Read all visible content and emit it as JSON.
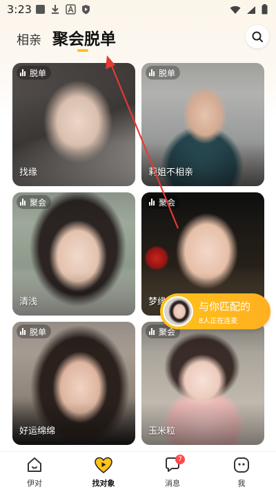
{
  "status_bar": {
    "time": "3:23"
  },
  "tabs": {
    "inactive": "相亲",
    "active": "聚会脱单"
  },
  "cards": [
    {
      "badge": "脱单",
      "name": "找缘",
      "palette": [
        "#6d6560",
        "#3b3735"
      ]
    },
    {
      "badge": "脱单",
      "name": "莉姐不相亲",
      "palette": [
        "#8a8f92",
        "#2d4b52"
      ]
    },
    {
      "badge": "聚会",
      "name": "清浅",
      "palette": [
        "#7f8c7c",
        "#c9ccc2"
      ]
    },
    {
      "badge": "聚会",
      "name": "梦缘",
      "palette": [
        "#1a1a1a",
        "#5b4638"
      ]
    },
    {
      "badge": "脱单",
      "name": "好运绵绵",
      "palette": [
        "#9b9289",
        "#5e554d"
      ]
    },
    {
      "badge": "聚会",
      "name": "玉米粒",
      "palette": [
        "#a7a39a",
        "#e8d6cf"
      ]
    }
  ],
  "match_popup": {
    "title": "与你匹配的",
    "subtitle": "8人正在连麦"
  },
  "bottom_nav": [
    {
      "label": "伊对",
      "icon": "home-icon"
    },
    {
      "label": "找对象",
      "icon": "heart-play-icon"
    },
    {
      "label": "消息",
      "icon": "message-icon",
      "badge": "7"
    },
    {
      "label": "我",
      "icon": "profile-icon"
    }
  ],
  "colors": {
    "accent": "#ffc21a",
    "annotation": "#e53935"
  }
}
